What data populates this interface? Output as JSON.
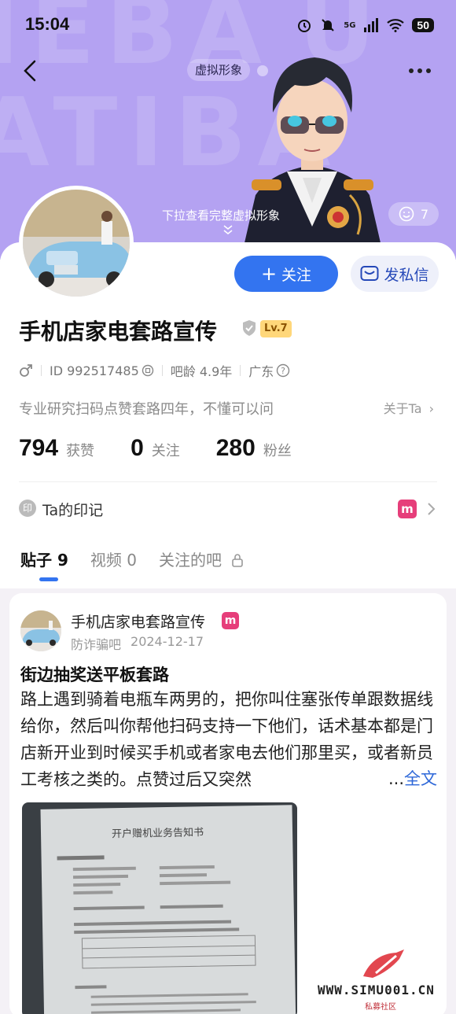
{
  "status_bar": {
    "time": "15:04",
    "battery": "50",
    "network": "5G"
  },
  "header": {
    "virtual_avatar_label": "虚拟形象",
    "pull_hint": "下拉查看完整虚拟形象",
    "likes_count": "7",
    "bg_color": "#b4a2f2"
  },
  "profile": {
    "follow_label": "关注",
    "message_label": "发私信",
    "username": "手机店家电套路宣传",
    "level": "Lv.7",
    "gender_icon": "male-icon",
    "id_text": "ID 992517485",
    "bar_age": "吧龄 4.9年",
    "region": "广东",
    "bio": "专业研究扫码点赞套路四年，不懂可以问",
    "about_label": "关于Ta",
    "stats": [
      {
        "value": "794",
        "label": "获赞"
      },
      {
        "value": "0",
        "label": "关注"
      },
      {
        "value": "280",
        "label": "粉丝"
      }
    ],
    "mark_icon_text": "印",
    "mark_label": "Ta的印记",
    "mark_badge": "m"
  },
  "tabs": [
    {
      "label": "贴子 9"
    },
    {
      "label": "视频 0"
    },
    {
      "label": "关注的吧"
    }
  ],
  "post": {
    "author": "手机店家电套路宣传",
    "author_badge": "m",
    "forum": "防诈骗吧",
    "date": "2024-12-17",
    "title": "街边抽奖送平板套路",
    "body": "路上遇到骑着电瓶车两男的，把你叫住塞张传单跟数据线给你，然后叫你帮他扫码支持一下他们，话术基本都是门店新开业到时候买手机或者家电去他们那里买，或者新员工考核之类的。点赞过后又突然",
    "more_prefix": "...",
    "more_link": "全文",
    "image_doc_title": "开户赠机业务告知书"
  },
  "watermark": {
    "text": "WWW.SIMU001.CN",
    "sub": "私募社区"
  },
  "colors": {
    "accent": "#3374f0",
    "badge_pink": "#e63e7a",
    "level_gold": "#ffd77a"
  }
}
